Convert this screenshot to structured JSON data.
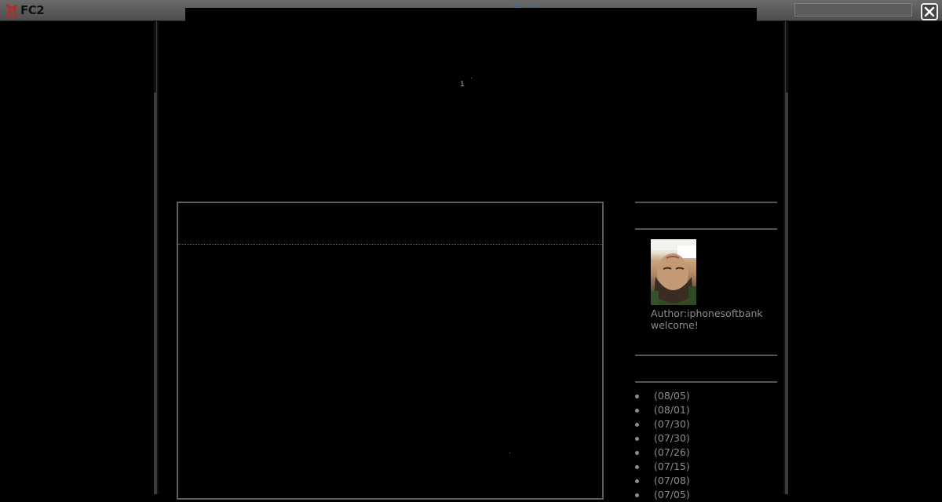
{
  "topbar": {
    "logo_text": "FC2",
    "logo_icon": "fc2-fox-icon",
    "link_text": "[PR] [?] ...",
    "search_placeholder": "",
    "close_icon": "close-icon"
  },
  "header": {
    "number": "1"
  },
  "profile": {
    "author": "Author:iphonesoftbank",
    "greeting": "welcome!"
  },
  "recent_entries": [
    {
      "date": "(08/05)"
    },
    {
      "date": "(08/01)"
    },
    {
      "date": "(07/30)"
    },
    {
      "date": "(07/30)"
    },
    {
      "date": "(07/26)"
    },
    {
      "date": "(07/15)"
    },
    {
      "date": "(07/08)"
    },
    {
      "date": "(07/05)"
    }
  ],
  "colors": {
    "background": "#000000",
    "topbar": "#5a5a5a",
    "border": "#5e5e5e",
    "text": "#8c8c8c",
    "link": "#3a6fb0"
  }
}
